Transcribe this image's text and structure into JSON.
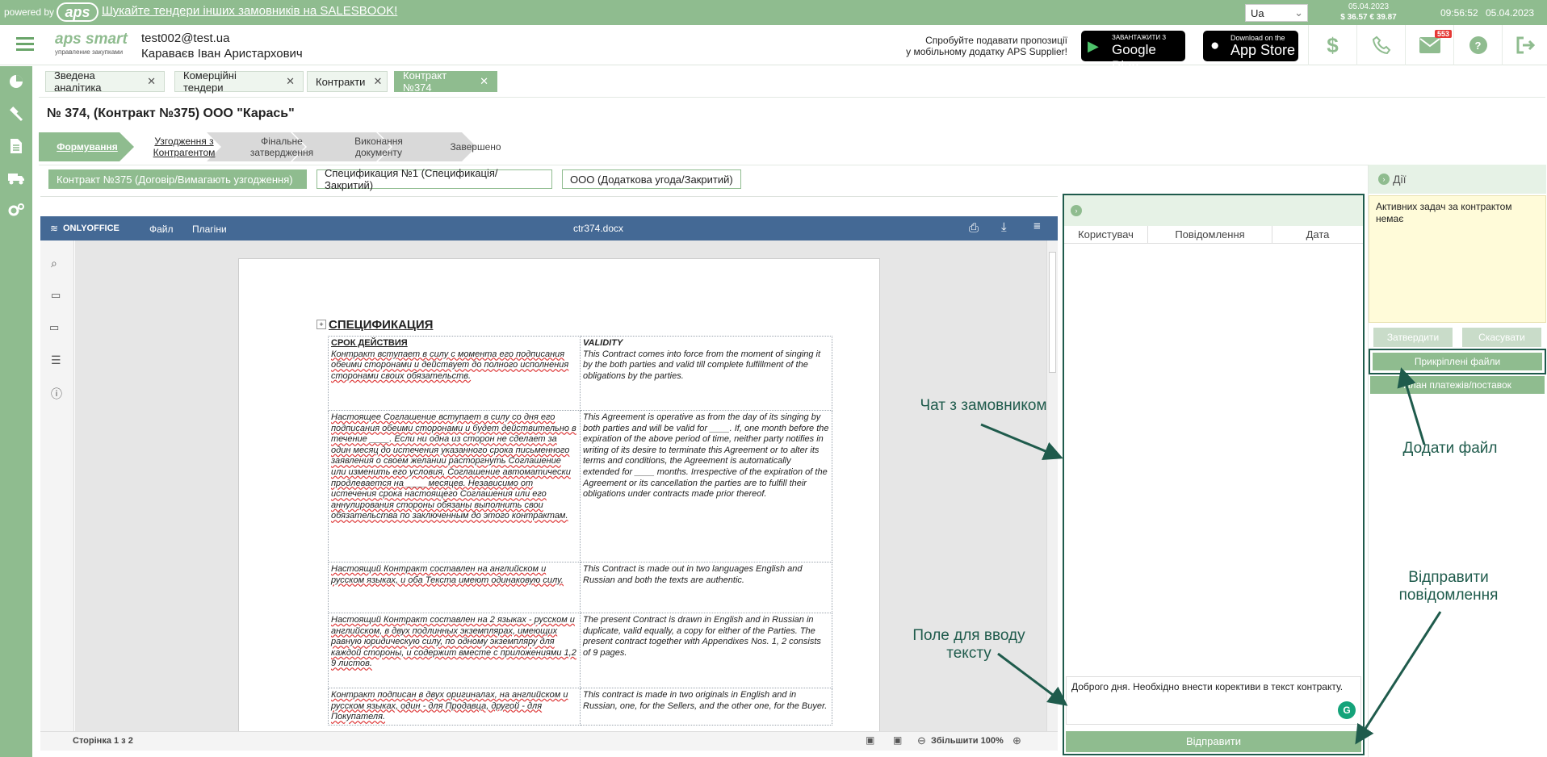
{
  "topbar": {
    "powered_by": "powered by",
    "logo": "aps",
    "promo_link": "Шукайте тендери інших замовників на SALESBOOK!",
    "language": "Ua",
    "rates_date": "05.04.2023",
    "rates": "$ 36.57  € 39.87",
    "time": "09:56:52",
    "date": "05.04.2023"
  },
  "header": {
    "logo_text": "aps smart",
    "logo_sub": "управление закупками",
    "email": "test002@test.ua",
    "user_name": "Караваєв Іван Аристархович",
    "promo_line1": "Спробуйте подавати пропозиції",
    "promo_line2": "у мобільному додатку APS Supplier!",
    "google_small": "ЗАВАНТАЖИТИ З",
    "google_big": "Google Play",
    "apple_small": "Download on the",
    "apple_big": "App Store",
    "mail_badge": "553"
  },
  "tabs": [
    {
      "label": "Зведена аналітика"
    },
    {
      "label": "Комерційні тендери"
    },
    {
      "label": "Контракти"
    },
    {
      "label": "Контракт №374"
    }
  ],
  "page_title": "№ 374, (Контракт №375) ООО \"Карась\"",
  "steps": [
    {
      "label": "Формування"
    },
    {
      "label": "Узгодження з Контрагентом"
    },
    {
      "label": "Фінальне затвердження"
    },
    {
      "label": "Виконання документу"
    },
    {
      "label": "Завершено"
    }
  ],
  "doc_links": [
    {
      "label": "Контракт №375 (Договір/Вимагають узгодження)"
    },
    {
      "label": "Спецификация №1 (Спецификація/Закритий)"
    },
    {
      "label": "ООО (Додаткова угода/Закритий)"
    }
  ],
  "editor": {
    "brand": "ONLYOFFICE",
    "menu_file": "Файл",
    "menu_plugins": "Плагіни",
    "filename": "ctr374.docx",
    "page_info": "Сторінка 1 з 2",
    "zoom": "Збільшити 100%"
  },
  "document": {
    "heading": "СПЕЦИФИКАЦИЯ",
    "rows": [
      {
        "ru_title": "СРОК ДЕЙСТВИЯ",
        "ru": "Контракт вступает в силу с момента его подписания обеими сторонами и действует до полного исполнения сторонами своих обязательств.",
        "en_title": "VALIDITY",
        "en": "This Contract comes into force from the moment of singing it by the both parties and valid till complete fulfillment of the obligations by the parties."
      },
      {
        "ru_title": "",
        "ru": "Настоящее Соглашение вступает в силу со дня его подписания обеими сторонами и будет действительно в течение ____. Если ни одна из сторон не сделает за один месяц до истечения указанного срока письменного заявления о своем желании расторгнуть Соглашение или изменить его условия, Соглашение автоматически продлевается на ____ месяцев. Независимо от истечения срока настоящего Соглашения или его аннулирования стороны обязаны выполнить свои обязательства по заключенным до этого контрактам.",
        "en_title": "",
        "en": "This Agreement is operative as from the day of its singing by both parties and will be valid for ____. If, one month before the expiration of the above period of time, neither party notifies in writing of its desire to terminate this Agreement or to alter its terms and conditions, the Agreement is automatically extended for ____ months. Irrespective of the expiration of the Agreement or its cancellation the parties are to fulfill their obligations under contracts made prior thereof."
      },
      {
        "ru_title": "",
        "ru": "Настоящий Контракт составлен на английском и русском языках, и оба Текста имеют одинаковую силу.",
        "en_title": "",
        "en": "This Contract is made out in two languages English and Russian and both the texts are authentic."
      },
      {
        "ru_title": "",
        "ru": "Настоящий Контракт составлен на 2 языках - русском и английском, в двух подлинных экземплярах, имеющих равную юридическую силу, по одному экземпляру для каждой стороны, и содержит вместе с приложениями 1,2 9 листов.",
        "en_title": "",
        "en": "The present Contract is drawn in English and in Russian in duplicate, valid equally, a copy for either of the Parties. The present contract together with Appendixes Nos. 1, 2 consists of 9 pages."
      },
      {
        "ru_title": "",
        "ru": "Контракт подписан в двух оригиналах, на английском и русском языках, один - для Продавца, другой - для Покупателя.",
        "en_title": "",
        "en": "This contract is made in two originals in English and in Russian, one, for the Sellers, and the other one, for the Buyer."
      }
    ]
  },
  "chat": {
    "col_user": "Користувач",
    "col_message": "Повідомлення",
    "col_date": "Дата",
    "input_value": "Доброго дня. Необхідно внести корективи в текст контракту.",
    "send_label": "Відправити"
  },
  "actions": {
    "title": "Дії",
    "no_tasks": "Активних задач за контрактом немає",
    "approve": "Затвердити",
    "cancel": "Скасувати",
    "attached_files": "Прикріплені файли",
    "payment_plan": "План платежів/поставок"
  },
  "annotations": {
    "chat": "Чат з замовником",
    "add_file": "Додати файл",
    "send_msg": "Відправити повідомлення",
    "input_field": "Поле для вводу тексту"
  },
  "colors": {
    "brand_green": "#8fbc8f",
    "annotation": "#1f5b4c",
    "editor_bar": "#446995",
    "actions_bg": "#fffbd9"
  }
}
